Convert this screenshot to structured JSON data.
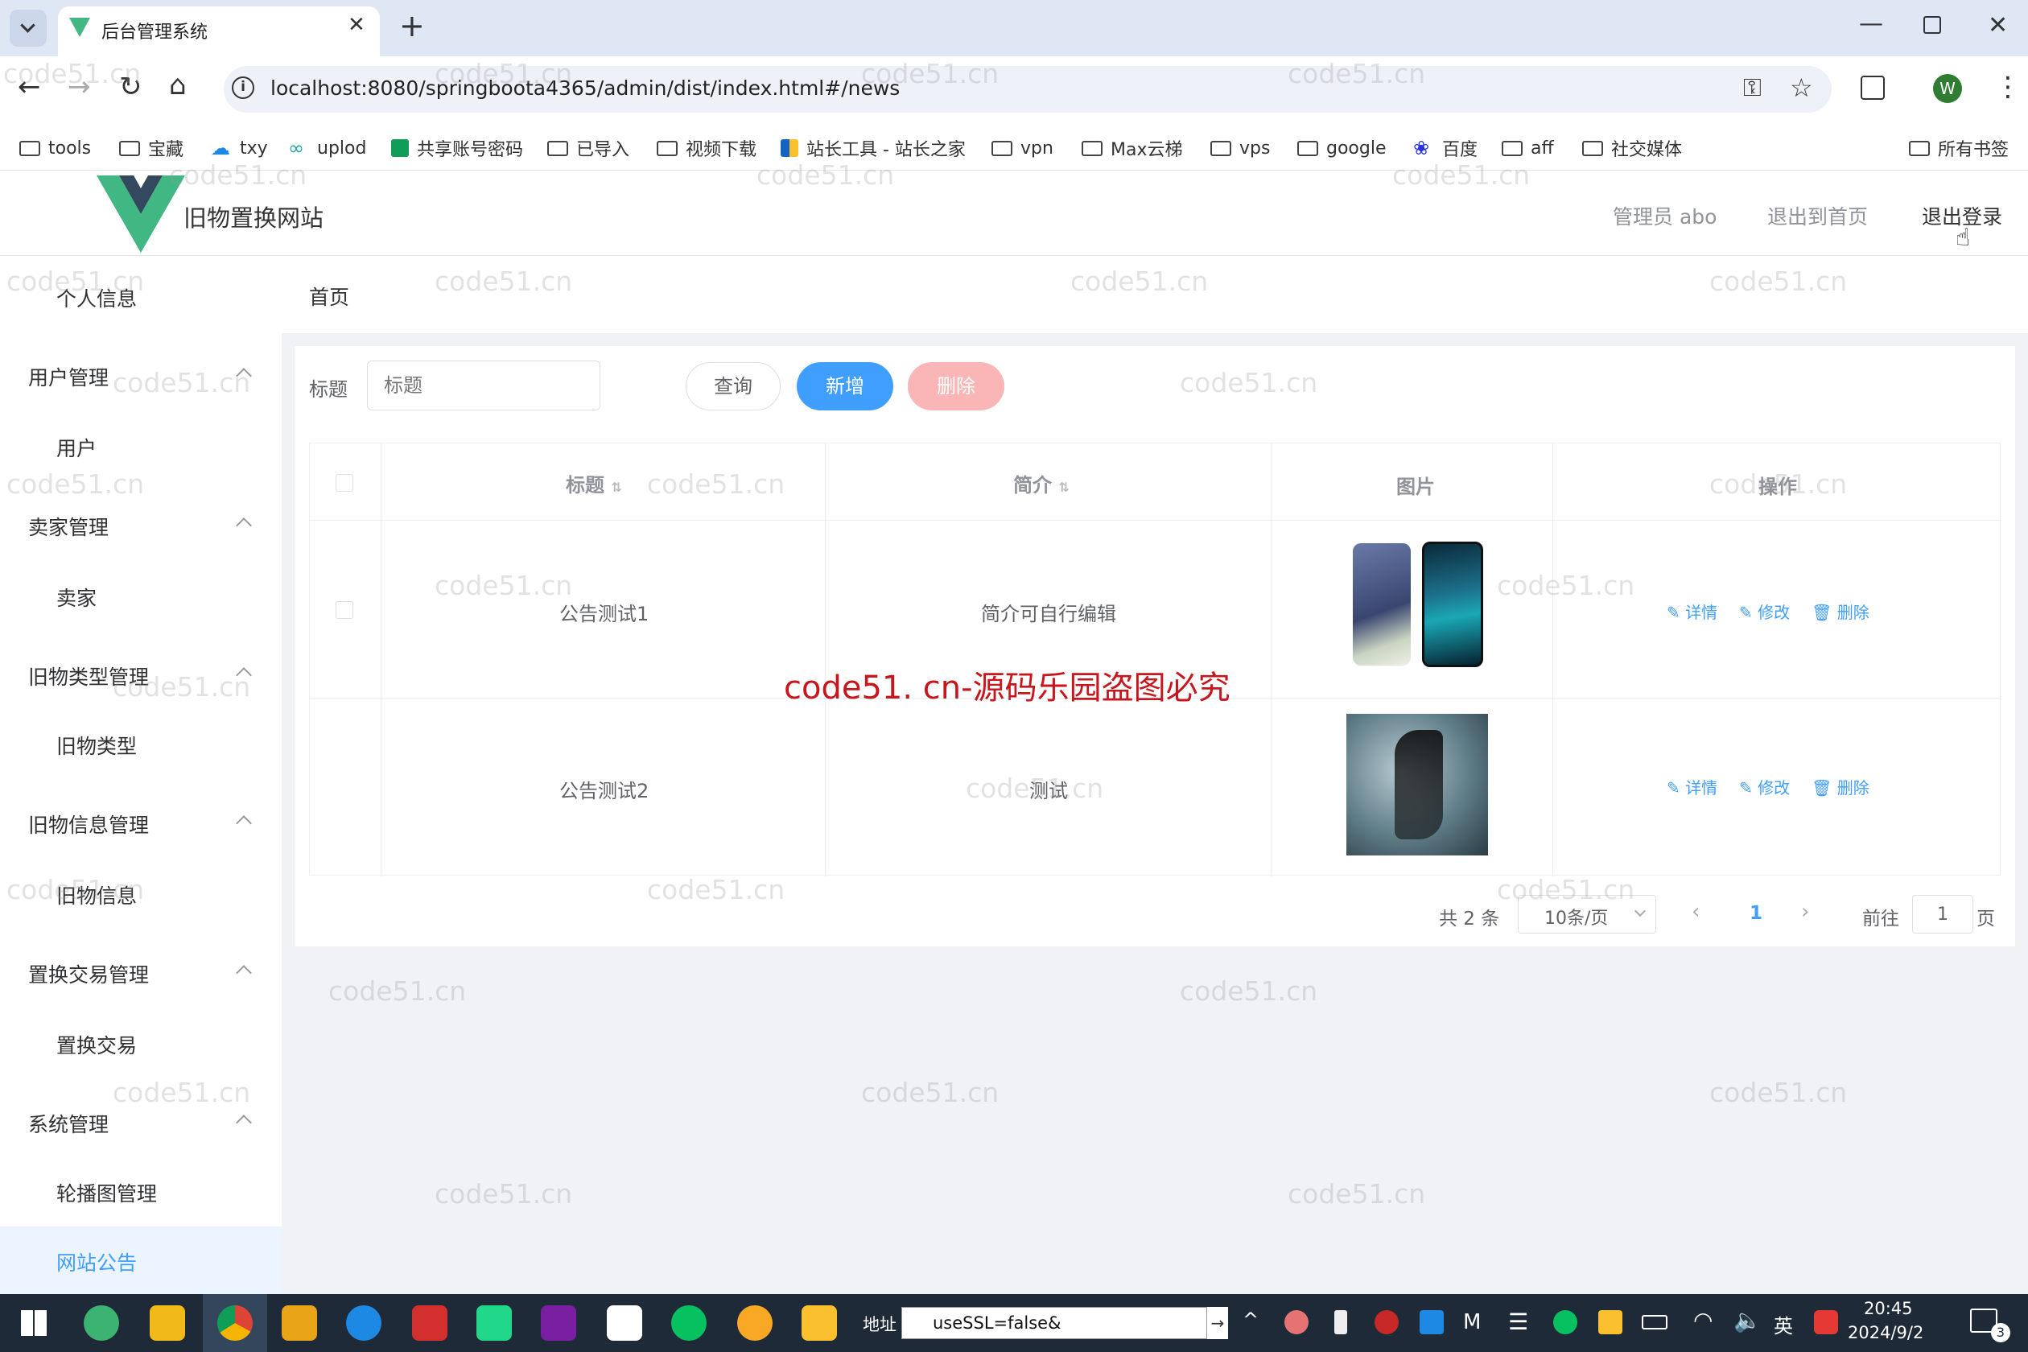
{
  "browser": {
    "tab_title": "后台管理系统",
    "new_tab": "+",
    "url": "localhost:8080/springboota4365/admin/dist/index.html#/news",
    "profile_initial": "W",
    "bookmarks": [
      "tools",
      "宝藏",
      "txy",
      "uplod",
      "共享账号密码",
      "已导入",
      "视频下载",
      "站长工具 - 站长之家",
      "vpn",
      "Max云梯",
      "vps",
      "google",
      "百度",
      "aff",
      "社交媒体"
    ],
    "all_bookmarks": "所有书签"
  },
  "header": {
    "site_name": "旧物置换网站",
    "user": "管理员 abo",
    "back_home": "退出到首页",
    "logout": "退出登录"
  },
  "sidebar": {
    "profile": "个人信息",
    "groups": [
      {
        "title": "用户管理",
        "item": "用户"
      },
      {
        "title": "卖家管理",
        "item": "卖家"
      },
      {
        "title": "旧物类型管理",
        "item": "旧物类型"
      },
      {
        "title": "旧物信息管理",
        "item": "旧物信息"
      },
      {
        "title": "置换交易管理",
        "item": "置换交易"
      },
      {
        "title": "系统管理",
        "item": "轮播图管理"
      }
    ],
    "active_item": "网站公告"
  },
  "breadcrumb": "首页",
  "search": {
    "label": "标题",
    "placeholder": "标题",
    "query_btn": "查询",
    "add_btn": "新增",
    "delete_btn": "删除"
  },
  "table": {
    "headers": [
      "标题",
      "简介",
      "图片",
      "操作"
    ],
    "rows": [
      {
        "title": "公告测试1",
        "intro": "简介可自行编辑"
      },
      {
        "title": "公告测试2",
        "intro": "测试"
      }
    ],
    "actions": {
      "detail": "详情",
      "edit": "修改",
      "delete": "删除"
    }
  },
  "pagination": {
    "total": "共 2 条",
    "page_size": "10条/页",
    "current": "1",
    "goto": "前往",
    "goto_value": "1",
    "page_suffix": "页"
  },
  "watermark": {
    "repeat": "code51.cn",
    "center": "code51. cn-源码乐园盗图必究"
  },
  "taskbar": {
    "address_label": "地址",
    "address_value": "useSSL=false&",
    "ime": "英",
    "time": "20:45",
    "date": "2024/9/2",
    "notifications": "3"
  },
  "colors": {
    "primary": "#409eff",
    "danger_light": "#fab6b6",
    "active_bg": "#ecf5ff",
    "logo_green": "#41b883",
    "logo_dark": "#35495e"
  }
}
